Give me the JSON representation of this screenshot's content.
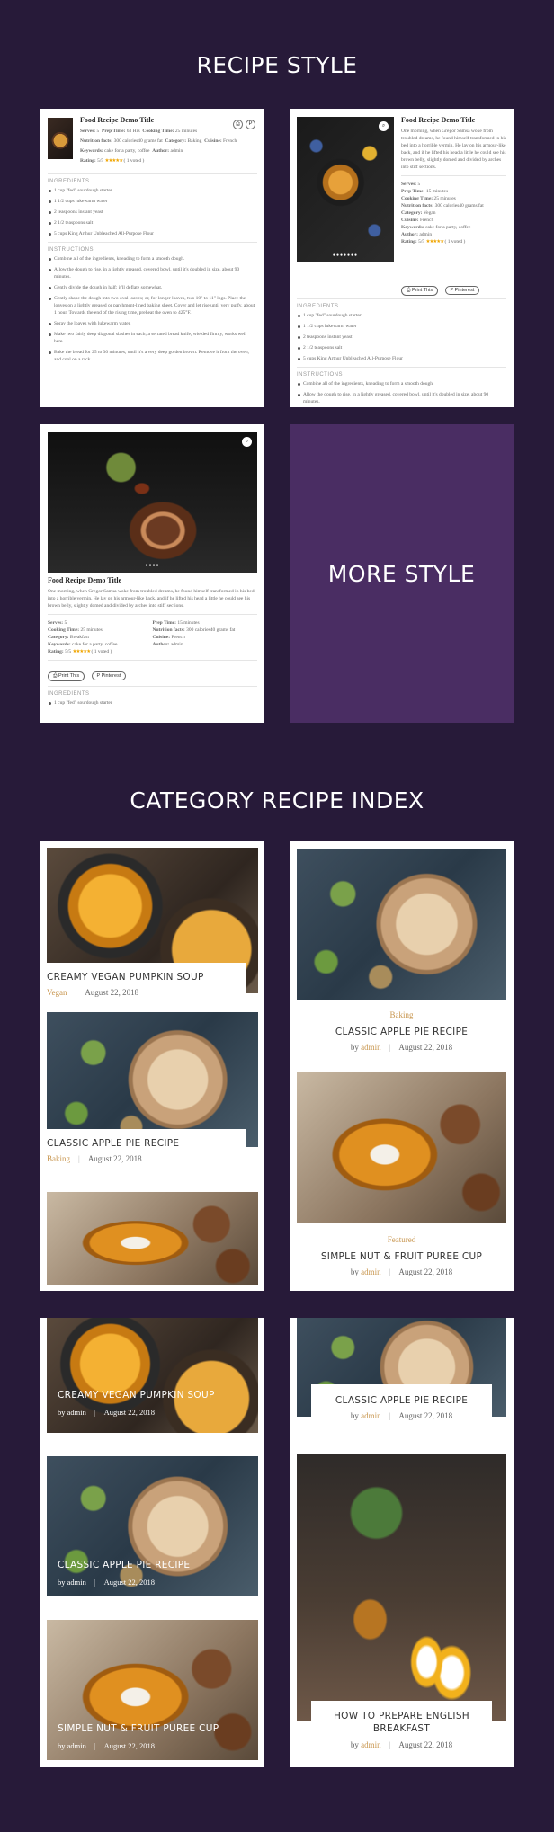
{
  "sections": {
    "recipe_style": "RECIPE STYLE",
    "more_style": "MORE STYLE",
    "category_index": "CATEGORY RECIPE INDEX"
  },
  "recipe": {
    "title": "Food Recipe Demo Title",
    "serves_label": "Serves:",
    "serves": "5",
    "prep_label": "Prep Time:",
    "prep": "63 Hrs",
    "prep2": "15 minutes",
    "cook_label": "Cooking Time:",
    "cook": "25 minutes",
    "nutrition_label": "Nutrition facts:",
    "nutrition": "300 calories40 grams fat",
    "category_label": "Category:",
    "category": "Baking",
    "category_b": "Vegan",
    "category_c": "Breakfast",
    "cuisine_label": "Cuisine:",
    "cuisine": "French",
    "keywords_label": "Keywords:",
    "keywords": "cake for a party, coffee",
    "author_label": "Author:",
    "author": "admin",
    "rating_label": "Rating:",
    "rating": "5/5",
    "stars": "★★★★★",
    "voted": "( 1 voted )",
    "print_btn": "Print This",
    "pinterest_btn": "Pinterest",
    "desc": "One morning, when Gregor Samsa woke from troubled dreams, he found himself transformed in his bed into a horrible vermin. He lay on his armour-like back, and if he lifted his head a little he could see his brown belly, slightly domed and divided by arches into stiff sections.",
    "ingredients_label": "INGREDIENTS",
    "ingredients": [
      "1 cup \"fed\" sourdough starter",
      "1 1/2 cups lukewarm water",
      "2 teaspoons instant yeast",
      "2 1/2 teaspoons salt",
      "5 cups King Arthur Unbleached All-Purpose Flour"
    ],
    "instructions_label": "INSTRUCTIONS",
    "instructions": [
      "Combine all of the ingredients, kneading to form a smooth dough.",
      "Allow the dough to rise, in a lightly greased, covered bowl, until it's doubled in size, about 90 minutes.",
      "Gently divide the dough in half; it'll deflate somewhat.",
      "Gently shape the dough into two oval loaves; or, for longer loaves, two 10\" to 11\" logs. Place the loaves on a lightly greased or parchment-lined baking sheet. Cover and let rise until very puffy, about 1 hour. Towards the end of the rising time, preheat the oven to 425°F.",
      "Spray the loaves with lukewarm water.",
      "Make two fairly deep diagonal slashes in each; a serrated bread knife, wielded firmly, works well here.",
      "Bake the bread for 25 to 30 minutes, until it's a very deep golden brown. Remove it from the oven, and cool on a rack."
    ],
    "instructions_short": [
      "Combine all of the ingredients, kneading to form a smooth dough.",
      "Allow the dough to rise, in a lightly greased, covered bowl, until it's doubled in size, about 90 minutes."
    ],
    "ingredient_first": "1 cup \"fed\" sourdough starter"
  },
  "category_index": {
    "by": "by",
    "date": "August 22, 2018",
    "cards": [
      {
        "title": "CREAMY VEGAN PUMPKIN SOUP",
        "cat": "Vegan"
      },
      {
        "title": "CLASSIC APPLE PIE RECIPE",
        "cat": "Baking"
      },
      {
        "title": "CLASSIC APPLE PIE RECIPE",
        "cat": "Baking",
        "author": "admin"
      },
      {
        "title": "SIMPLE NUT & FRUIT PUREE CUP",
        "cat": "Featured",
        "author": "admin"
      },
      {
        "title": "CREAMY VEGAN PUMPKIN SOUP",
        "author": "admin"
      },
      {
        "title": "CLASSIC APPLE PIE RECIPE",
        "author": "admin"
      },
      {
        "title": "SIMPLE NUT & FRUIT PUREE CUP",
        "author": "admin"
      },
      {
        "title": "CLASSIC APPLE PIE RECIPE",
        "author": "admin"
      },
      {
        "title": "HOW TO PREPARE ENGLISH BREAKFAST",
        "author": "admin"
      }
    ]
  }
}
